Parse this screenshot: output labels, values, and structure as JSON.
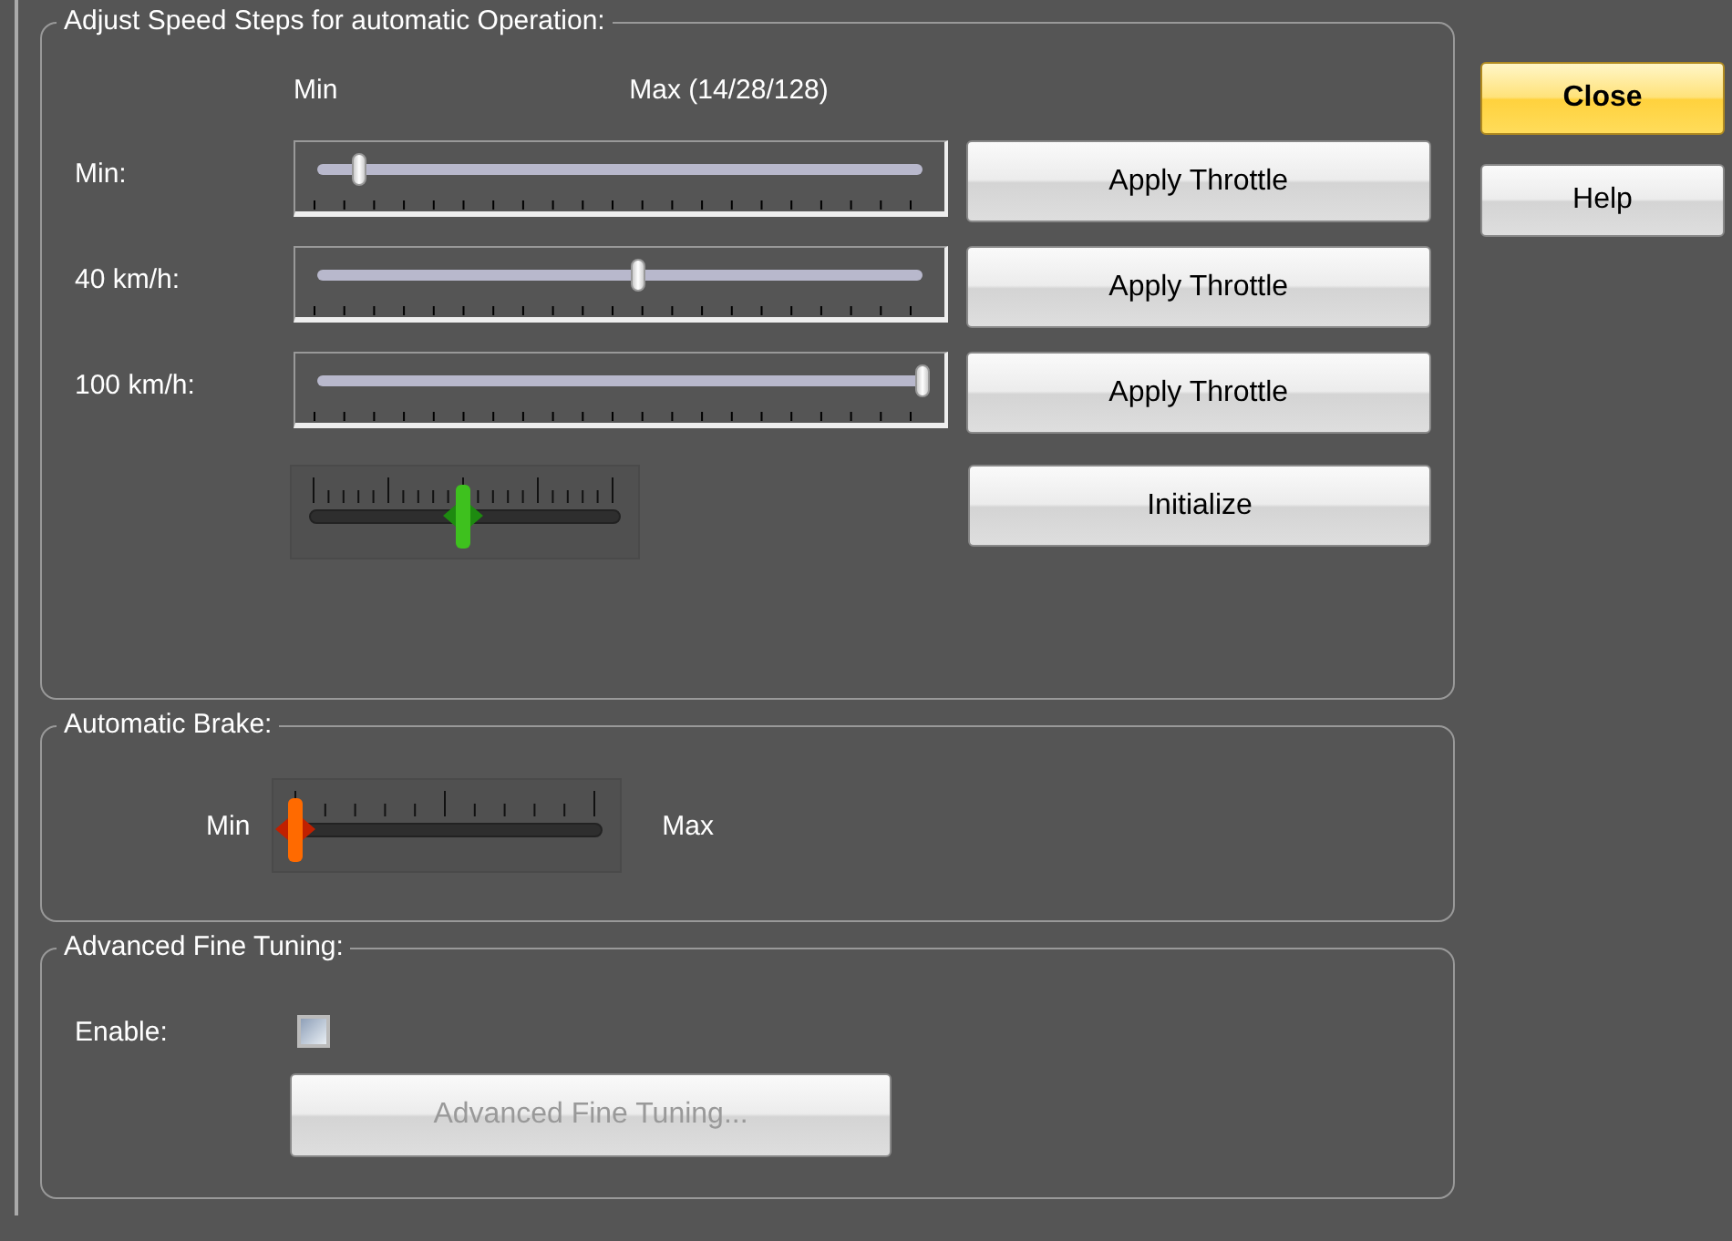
{
  "speed_steps": {
    "title": "Adjust Speed Steps for automatic Operation:",
    "min_heading": "Min",
    "max_heading": "Max (14/28/128)",
    "rows": [
      {
        "label": "Min:",
        "level": 0.07,
        "button": "Apply Throttle"
      },
      {
        "label": "40 km/h:",
        "level": 0.53,
        "button": "Apply Throttle"
      },
      {
        "label": "100 km/h:",
        "level": 1.0,
        "button": "Apply Throttle"
      }
    ],
    "curve_slider": {
      "level": 0.5
    },
    "initialize_button": "Initialize"
  },
  "automatic_brake": {
    "title": "Automatic Brake:",
    "min_label": "Min",
    "max_label": "Max",
    "slider": {
      "level": 0.0
    }
  },
  "advanced": {
    "title": "Advanced Fine Tuning:",
    "enable_label": "Enable:",
    "enable_checked": false,
    "button": {
      "label": "Advanced Fine Tuning...",
      "disabled": true
    }
  },
  "side_buttons": [
    {
      "label": "Close",
      "kind": "default"
    },
    {
      "label": "Help",
      "kind": "normal"
    }
  ]
}
